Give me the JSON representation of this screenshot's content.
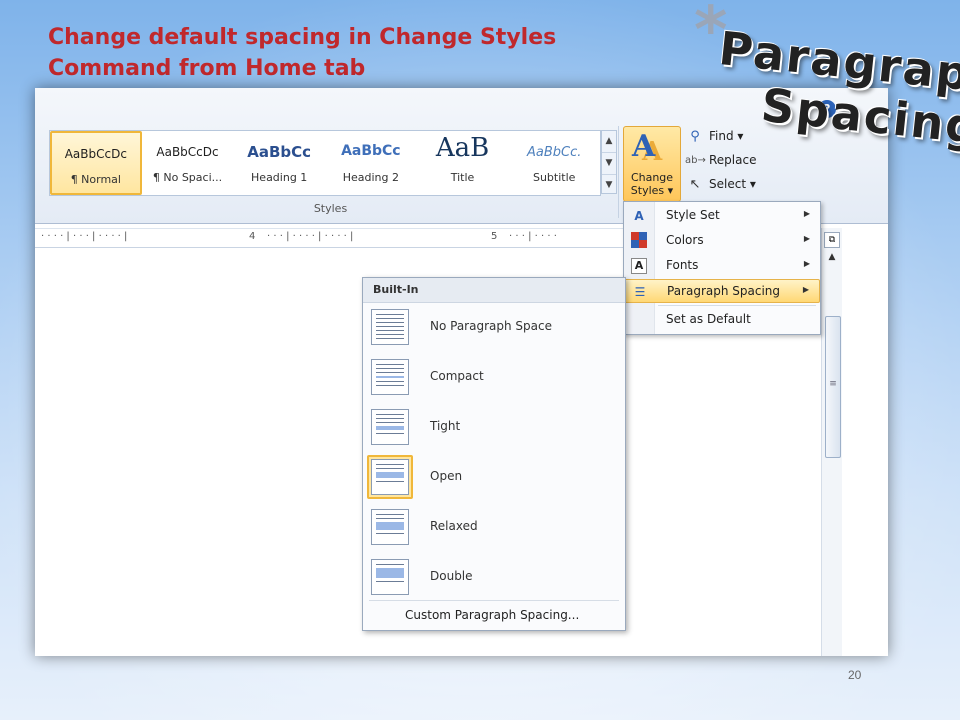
{
  "slide": {
    "title_line1": "Change default spacing in Change Styles",
    "title_line2": "Command from Home tab",
    "star": "*",
    "big_title_line1": "Paragraph",
    "big_title_line2": "Spacing",
    "page_number": "20"
  },
  "ribbon": {
    "styles_gallery": [
      {
        "preview": "AaBbCcDc",
        "name": "¶ Normal",
        "selected": true
      },
      {
        "preview": "AaBbCcDc",
        "name": "¶ No Spaci...",
        "selected": false
      },
      {
        "preview": "AaBbCc",
        "name": "Heading 1",
        "selected": false
      },
      {
        "preview": "AaBbCc",
        "name": "Heading 2",
        "selected": false
      },
      {
        "preview": "AaB",
        "name": "Title",
        "selected": false
      },
      {
        "preview": "AaBbCc.",
        "name": "Subtitle",
        "selected": false
      }
    ],
    "styles_group_label": "Styles",
    "change_styles_label_1": "Change",
    "change_styles_label_2": "Styles ▾",
    "editing": {
      "find": "Find ▾",
      "replace": "Replace",
      "select": "Select ▾"
    }
  },
  "ruler": {
    "mark_4": "4",
    "mark_5": "5"
  },
  "change_styles_menu": {
    "items": [
      {
        "label": "Style Set",
        "has_submenu": true
      },
      {
        "label": "Colors",
        "has_submenu": true
      },
      {
        "label": "Fonts",
        "has_submenu": true
      },
      {
        "label": "Paragraph Spacing",
        "has_submenu": true
      },
      {
        "label": "Set as Default",
        "has_submenu": false
      }
    ],
    "highlighted": "Paragraph Spacing"
  },
  "paragraph_spacing_flyout": {
    "header": "Built-In",
    "options": [
      {
        "label": "No Paragraph Space",
        "selected": false
      },
      {
        "label": "Compact",
        "selected": false
      },
      {
        "label": "Tight",
        "selected": false
      },
      {
        "label": "Open",
        "selected": true
      },
      {
        "label": "Relaxed",
        "selected": false
      },
      {
        "label": "Double",
        "selected": false
      }
    ],
    "custom": "Custom Paragraph Spacing..."
  },
  "colors": {
    "title_red": "#c0282c",
    "highlight": "#ffd875",
    "selected_border": "#f0b73a"
  }
}
